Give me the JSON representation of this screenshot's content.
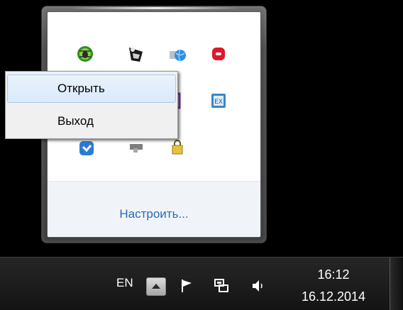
{
  "flyout": {
    "customize_label": "Настроить...",
    "icons": [
      "antivirus-bug-icon",
      "speaker-horn-icon",
      "network-globe-icon",
      "red-chat-icon",
      "purple-app-icon",
      "exchange-calendar-icon",
      "blue-shield-icon",
      "gray-device-icon",
      "yellow-lock-icon"
    ]
  },
  "context_menu": {
    "items": [
      {
        "label": "Открыть",
        "highlighted": true
      },
      {
        "label": "Выход",
        "highlighted": false
      }
    ]
  },
  "taskbar": {
    "language": "EN",
    "time": "16:12",
    "date": "16.12.2014",
    "icons": [
      "show-hidden-icons-arrow",
      "action-center-flag-icon",
      "network-icon",
      "volume-icon"
    ]
  },
  "colors": {
    "desktop": "#000000",
    "link": "#2a6ab8",
    "menu_highlight": "#d9e9fb",
    "taskbar": "#1c1c1c"
  }
}
